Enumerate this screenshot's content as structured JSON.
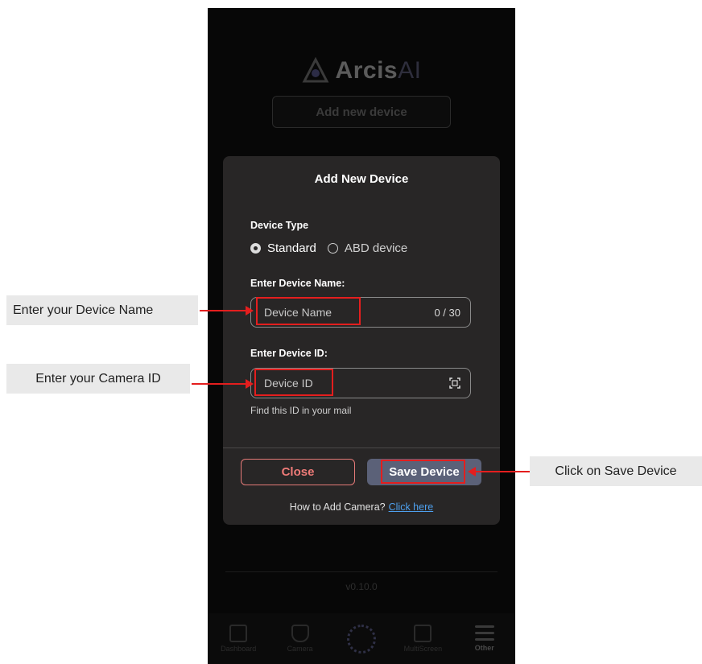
{
  "app": {
    "logo_name": "Arcis",
    "logo_suffix": "AI",
    "add_new_device_button": "Add new device",
    "version": "v0.10.0"
  },
  "tabbar": {
    "items": [
      {
        "label": "Dashboard",
        "icon": "dashboard-icon"
      },
      {
        "label": "Camera",
        "icon": "camera-icon"
      },
      {
        "label": "",
        "icon": "arcis-logo-icon"
      },
      {
        "label": "MultiScreen",
        "icon": "multiscreen-icon"
      },
      {
        "label": "Other",
        "icon": "menu-icon"
      }
    ]
  },
  "modal": {
    "title": "Add New Device",
    "device_type_label": "Device Type",
    "device_types": [
      {
        "label": "Standard",
        "selected": true
      },
      {
        "label": "ABD device",
        "selected": false
      }
    ],
    "name_label": "Enter Device Name:",
    "name_placeholder": "Device Name",
    "name_counter": "0 / 30",
    "id_label": "Enter Device ID:",
    "id_placeholder": "Device ID",
    "id_hint": "Find this ID in your mail",
    "close_button": "Close",
    "save_button": "Save Device",
    "help_text": "How to Add Camera?",
    "help_link": "Click here"
  },
  "annotations": {
    "name_callout": "Enter your Device Name",
    "id_callout": "Enter your Camera ID",
    "save_callout": "Click on Save Device"
  },
  "colors": {
    "modal_bg": "#282626",
    "save_button": "#5b6178",
    "close_accent": "#ef7b78",
    "link": "#4ea0ee",
    "highlight": "#e41e1e"
  }
}
